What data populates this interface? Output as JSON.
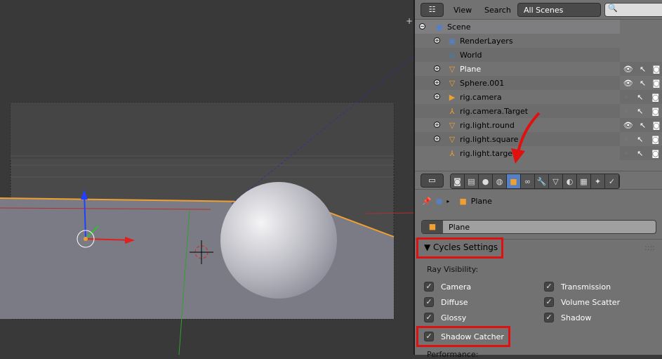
{
  "outliner": {
    "view_label": "View",
    "search_label": "Search",
    "scene_select": "All Scenes",
    "search_placeholder": "",
    "items": [
      {
        "label": "Scene",
        "icon": "scene-icon"
      },
      {
        "label": "RenderLayers",
        "icon": "render-layers-icon"
      },
      {
        "label": "World",
        "icon": "world-icon"
      },
      {
        "label": "Plane",
        "icon": "mesh-icon",
        "visible": true
      },
      {
        "label": "Sphere.001",
        "icon": "mesh-icon",
        "visible": true
      },
      {
        "label": "rig.camera",
        "icon": "camera-icon",
        "visible": false
      },
      {
        "label": "rig.camera.Target",
        "icon": "empty-icon",
        "visible": false
      },
      {
        "label": "rig.light.round",
        "icon": "mesh-icon",
        "visible": true
      },
      {
        "label": "rig.light.square",
        "icon": "mesh-icon",
        "visible": false
      },
      {
        "label": "rig.light.target",
        "icon": "empty-icon",
        "visible": false
      }
    ]
  },
  "properties": {
    "breadcrumb_object": "Plane",
    "object_name": "Plane",
    "panel_title": "Cycles Settings",
    "ray_visibility_label": "Ray Visibility:",
    "checks_left": [
      "Camera",
      "Diffuse",
      "Glossy"
    ],
    "checks_right": [
      "Transmission",
      "Volume Scatter",
      "Shadow"
    ],
    "shadow_catcher": "Shadow Catcher",
    "performance_label": "Performance:"
  },
  "colors": {
    "highlight": "#e01010",
    "accent": "#5680c2"
  }
}
